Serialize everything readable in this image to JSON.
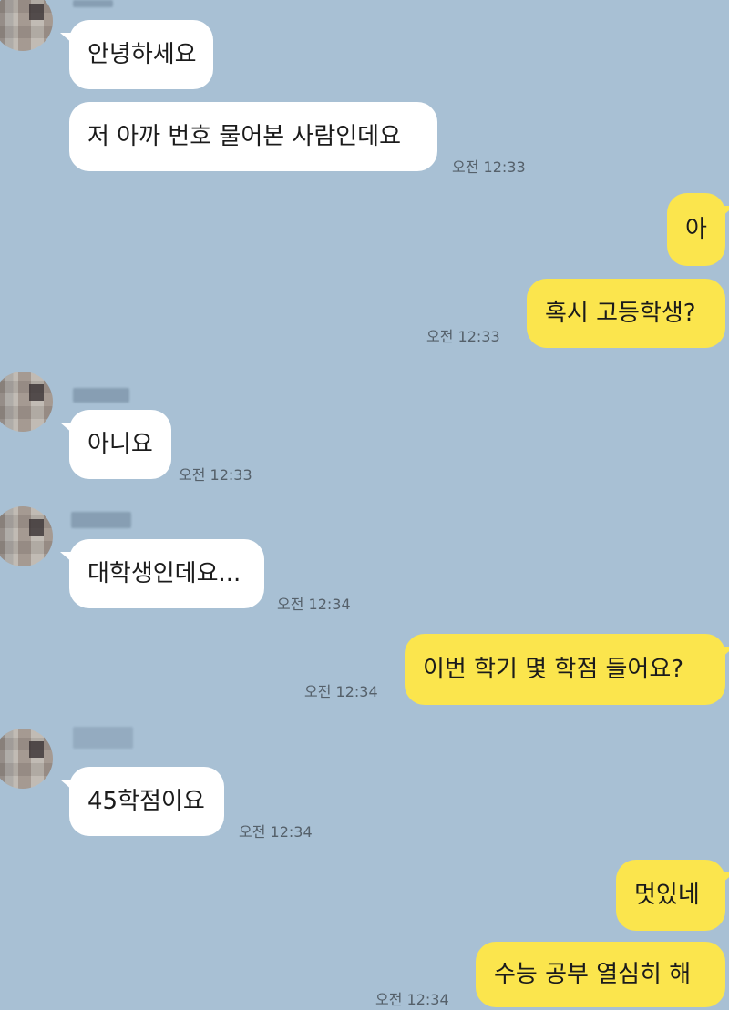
{
  "messages": [
    {
      "side": "in",
      "text": "안녕하세요",
      "time": ""
    },
    {
      "side": "in",
      "text": "저 아까 번호 물어본 사람인데요",
      "time": "오전 12:33"
    },
    {
      "side": "out",
      "text": "아",
      "time": ""
    },
    {
      "side": "out",
      "text": "혹시 고등학생?",
      "time": "오전 12:33"
    },
    {
      "side": "in",
      "text": "아니요",
      "time": "오전 12:33"
    },
    {
      "side": "in",
      "text": "대학생인데요...",
      "time": "오전 12:34"
    },
    {
      "side": "out",
      "text": "이번 학기 몇 학점 들어요?",
      "time": "오전 12:34"
    },
    {
      "side": "in",
      "text": "45학점이요",
      "time": "오전 12:34"
    },
    {
      "side": "out",
      "text": "멋있네",
      "time": ""
    },
    {
      "side": "out",
      "text": "수능 공부 열심히 해",
      "time": "오전 12:34"
    }
  ],
  "colors": {
    "background": "#a8c0d4",
    "incoming": "#ffffff",
    "outgoing": "#fbe54d"
  }
}
